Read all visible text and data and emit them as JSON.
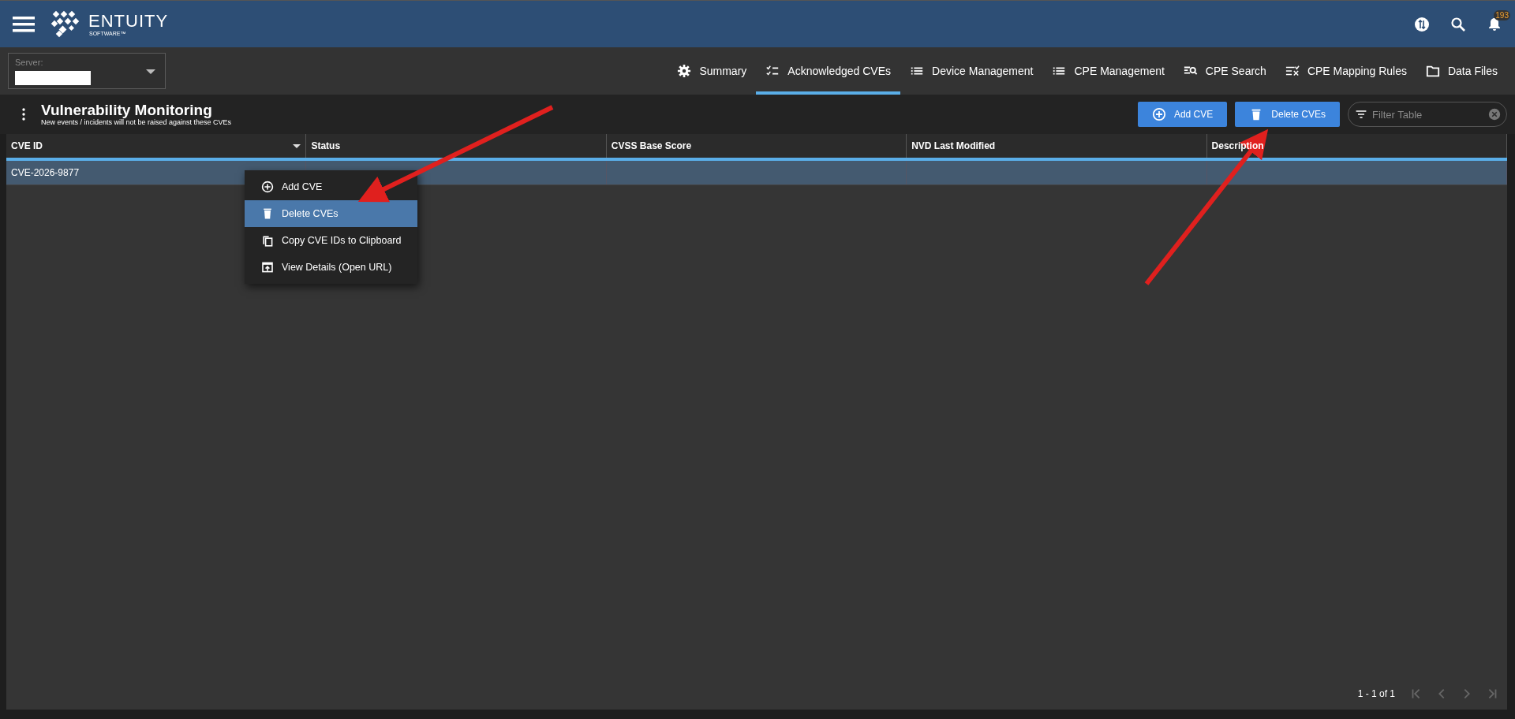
{
  "header": {
    "brand": "ENTUITY",
    "brand_sub": "SOFTWARE™",
    "notification_count": "193"
  },
  "server": {
    "label": "Server:"
  },
  "tabs": [
    {
      "label": "Summary",
      "kind": "gear",
      "selected": false
    },
    {
      "label": "Acknowledged CVEs",
      "kind": "checklist",
      "selected": true
    },
    {
      "label": "Device Management",
      "kind": "list",
      "selected": false
    },
    {
      "label": "CPE Management",
      "kind": "list",
      "selected": false
    },
    {
      "label": "CPE Search",
      "kind": "listsearch",
      "selected": false
    },
    {
      "label": "CPE Mapping Rules",
      "kind": "listx",
      "selected": false
    },
    {
      "label": "Data Files",
      "kind": "folder",
      "selected": false
    }
  ],
  "page": {
    "title": "Vulnerability Monitoring",
    "subtitle": "New events / incidents will not be raised against these CVEs"
  },
  "actions": [
    {
      "label": "Add CVE",
      "kind": "add"
    },
    {
      "label": "Delete CVEs",
      "kind": "delete"
    }
  ],
  "filter": {
    "placeholder": "Filter Table"
  },
  "table": {
    "columns": [
      {
        "label": "CVE ID",
        "sorted": true
      },
      {
        "label": "Status",
        "sorted": false
      },
      {
        "label": "CVSS Base Score",
        "sorted": false
      },
      {
        "label": "NVD Last Modified",
        "sorted": false
      },
      {
        "label": "Description",
        "sorted": false
      }
    ],
    "rows": [
      {
        "cells": [
          "CVE-2026-9877",
          "",
          "",
          "",
          ""
        ],
        "selected": true
      }
    ]
  },
  "context_menu": [
    {
      "label": "Add CVE",
      "kind": "add",
      "selected": false
    },
    {
      "label": "Delete CVEs",
      "kind": "delete",
      "selected": true
    },
    {
      "label": "Copy CVE IDs to Clipboard",
      "kind": "copy",
      "selected": false
    },
    {
      "label": "View Details (Open URL)",
      "kind": "open",
      "selected": false
    }
  ],
  "pagination": {
    "range": "1 - 1 of 1"
  }
}
